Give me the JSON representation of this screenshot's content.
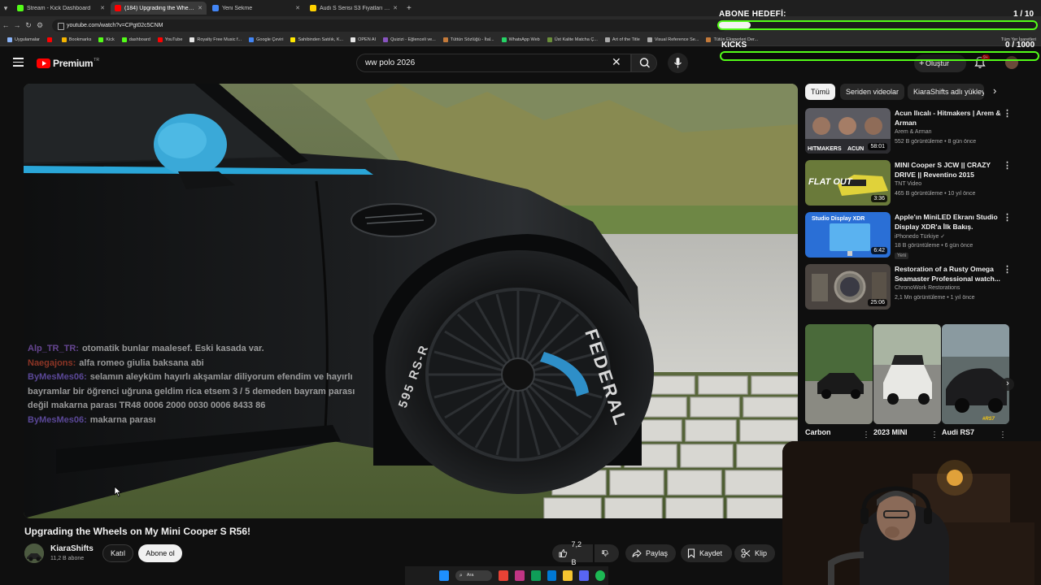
{
  "browser": {
    "tabs": [
      {
        "title": "Stream - Kick Dashboard",
        "fav": "#53fc18",
        "active": false
      },
      {
        "title": "(184) Upgrading the Wheels on My Mini Cooper S R56!",
        "fav": "#ff0000",
        "active": true
      },
      {
        "title": "Yeni Sekme",
        "fav": "#4285f4",
        "active": false
      },
      {
        "title": "Audi S Serisi S3 Fiyatları & Modelleri",
        "fav": "#ffd200",
        "active": false
      }
    ],
    "new_tab": "+",
    "url": "youtube.com/watch?v=CPgt02c5CNM",
    "bookmarks": [
      {
        "label": "Uygulamalar",
        "color": "#8ab4f8"
      },
      {
        "label": "",
        "color": "#ff0000"
      },
      {
        "label": "Bookmarks",
        "color": "#f4b400"
      },
      {
        "label": "Kick",
        "color": "#53fc18"
      },
      {
        "label": "dashboard",
        "color": "#53fc18"
      },
      {
        "label": "YouTube",
        "color": "#ff0000"
      },
      {
        "label": "Royalty Free Music f...",
        "color": "#e6e6e6"
      },
      {
        "label": "Google Çeviri",
        "color": "#4285f4"
      },
      {
        "label": "Sahibinden Satılık, K...",
        "color": "#ffe800"
      },
      {
        "label": "OPEN AI",
        "color": "#e6e6e6"
      },
      {
        "label": "Quizizi - Eğlenceli ve...",
        "color": "#8854c0"
      },
      {
        "label": "Tüttün Sözlüğü - İtal...",
        "color": "#c47a3a"
      },
      {
        "label": "WhatsApp Web",
        "color": "#25d366"
      },
      {
        "label": "Üst Kalite Matcha Ç...",
        "color": "#6a8f3a"
      },
      {
        "label": "Art of the Title",
        "color": "#aaaaaa"
      },
      {
        "label": "Visual Reference Se...",
        "color": "#aaaaaa"
      },
      {
        "label": "Tütün Eksperleri Der...",
        "color": "#c47a3a"
      }
    ],
    "all_bookmarks": "Tüm Yer İşaretleri"
  },
  "header": {
    "logo_word": "Premium",
    "logo_region": "TR",
    "search_value": "ww polo 2026",
    "create_label": "Oluştur",
    "notif_count": "9+"
  },
  "overlay": {
    "goal_label": "ABONE HEDEFİ:",
    "goal_count": "1 / 10",
    "goal_progress": 0.1,
    "kicks_label": "KICKS",
    "kicks_count": "0 / 1000",
    "kicks_progress": 0.0
  },
  "chat": [
    {
      "user": "Alp_TR_TR:",
      "color": "#8a5cc7",
      "text": "otomatik bunlar maalesef. Eski kasada var."
    },
    {
      "user": "Naegajons:",
      "color": "#c2452e",
      "text": "alfa romeo giulia baksana abi"
    },
    {
      "user": "ByMesMes06:",
      "color": "#7a5fd0",
      "text": "selamın aleyküm hayırlı akşamlar diliyorum efendim ve hayırlı bayramlar bir öğrenci uğruna geldim rica etsem 3 / 5 demeden bayram parası değil makarna parası TR48 0006 2000 0030 0006 8433 86"
    },
    {
      "user": "ByMesMes06:",
      "color": "#7a5fd0",
      "text": "makarna parası"
    }
  ],
  "video": {
    "title": "Upgrading the Wheels on My Mini Cooper S R56!",
    "channel": "KiaraShifts",
    "subs": "11,2 B abone",
    "join": "Katıl",
    "subscribe": "Abone ol",
    "likes": "7,2 B",
    "share": "Paylaş",
    "save": "Kaydet",
    "clip": "Klip",
    "tire_brand": "FEDERAL",
    "tire_model": "595 RS-R"
  },
  "chips": [
    "Tümü",
    "Seriden videolar",
    "KiaraShifts adlı yükleyiciden"
  ],
  "recommendations": [
    {
      "title": "Acun Ilıcalı - Hitmakers | Arem & Arman",
      "channel": "Arem & Arman",
      "meta": "552 B görüntüleme • 8 gün önce",
      "duration": "58:01",
      "badge": "",
      "thumb": "#6b6b70"
    },
    {
      "title": "MINI Cooper S JCW || CRAZY DRIVE || Reventino 2015",
      "channel": "TNT Video",
      "meta": "465 B görüntüleme • 10 yıl önce",
      "duration": "3:36",
      "badge": "",
      "thumb": "#b8a62e"
    },
    {
      "title": "Apple'ın MiniLED Ekranı Studio Display XDR'a İlk Bakış.",
      "channel": "iPhonedo Türkiye ✓",
      "meta": "18 B görüntüleme • 6 gün önce",
      "duration": "6:42",
      "badge": "Yeni",
      "thumb": "#2b6fd6"
    },
    {
      "title": "Restoration of a Rusty Omega Seamaster Professional watch...",
      "channel": "ChronoWork Restorations",
      "meta": "2,1 Mn görüntüleme • 1 yıl önce",
      "duration": "25:06",
      "badge": "",
      "thumb": "#5b5348"
    }
  ],
  "thumb_texts": {
    "hitmakers": "HITMAKERS",
    "acun": "ACUN",
    "flatout": "FLAT OUT",
    "studio": "Studio Display XDR"
  },
  "shorts": [
    {
      "title": "Carbon",
      "thumb": "#4a6a3a"
    },
    {
      "title": "2023 MINI",
      "thumb": "#8a8a85"
    },
    {
      "title": "Audi RS7",
      "thumb": "#5f6a6a"
    }
  ],
  "shorts_badge": "#RS7",
  "taskbar": {
    "search": "Ara"
  }
}
